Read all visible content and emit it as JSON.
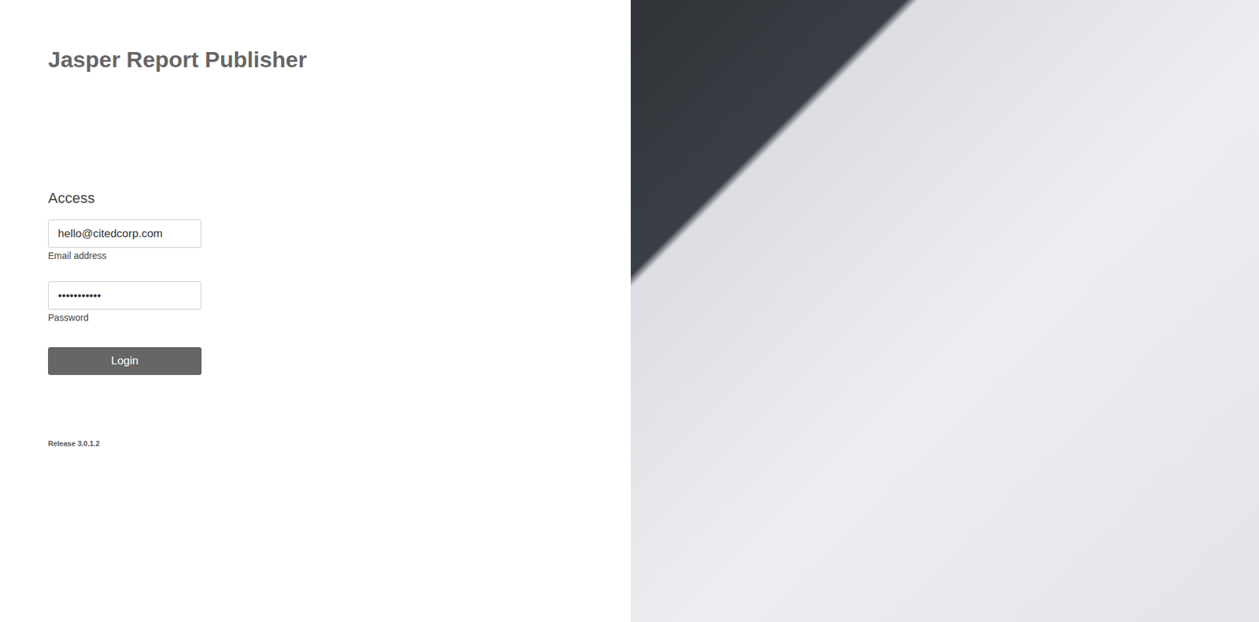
{
  "app": {
    "title": "Jasper Report Publisher"
  },
  "form": {
    "heading": "Access",
    "fields": [
      {
        "label": "Email address",
        "value": "hello@citedcorp.com",
        "kind": "email"
      },
      {
        "label": "Password",
        "value": "•••••••••••",
        "kind": "password"
      }
    ],
    "button": "Login"
  },
  "release": "Release 3.0.1.2"
}
